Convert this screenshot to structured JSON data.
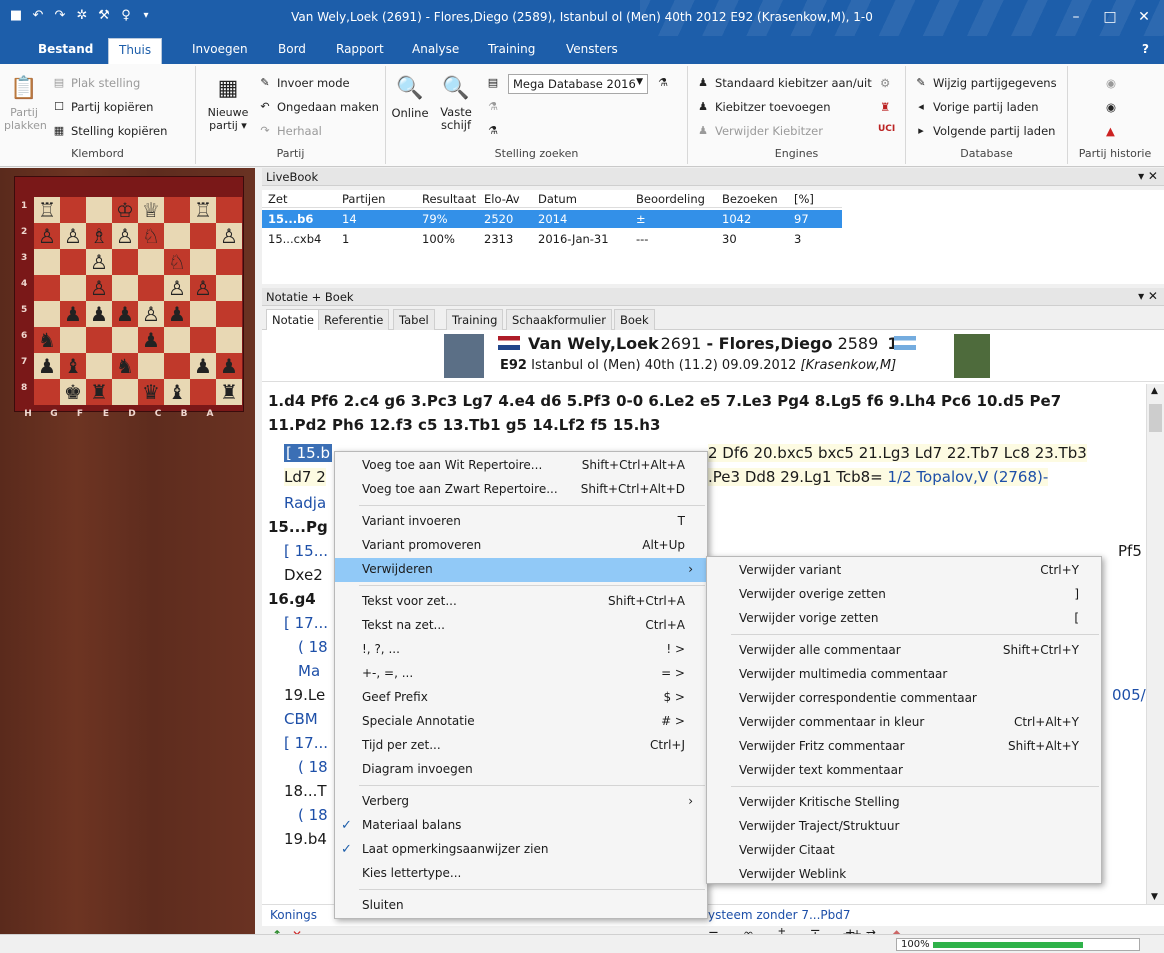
{
  "title": "Van Wely,Loek (2691) - Flores,Diego (2589), Istanbul ol (Men) 40th 2012  E92  (Krasenkow,M), 1-0",
  "menu": {
    "tabs": [
      "Bestand",
      "Thuis",
      "Invoegen",
      "Bord",
      "Rapport",
      "Analyse",
      "Training",
      "Vensters"
    ]
  },
  "ribbon": {
    "klembord": {
      "label": "Klembord",
      "partij_plakken": "Partij plakken",
      "plak_stelling": "Plak stelling",
      "partij_kopieren": "Partij kopiëren",
      "stelling_kopieren": "Stelling kopiëren"
    },
    "partij": {
      "label": "Partij",
      "nieuwe_partij": "Nieuwe partij ▾",
      "invoer_mode": "Invoer mode",
      "ongedaan": "Ongedaan maken",
      "herhaal": "Herhaal"
    },
    "stelling": {
      "label": "Stelling zoeken",
      "online": "Online",
      "vaste_schijf": "Vaste schijf",
      "database": "Mega Database 2016"
    },
    "engines": {
      "label": "Engines",
      "standaard": "Standaard kiebitzer aan/uit",
      "toevoegen": "Kiebitzer toevoegen",
      "verwijder": "Verwijder Kiebitzer"
    },
    "database": {
      "label": "Database",
      "wijzig": "Wijzig partijgegevens",
      "vorige": "Vorige partij laden",
      "volgende": "Volgende partij laden"
    },
    "historie": {
      "label": "Partij historie"
    }
  },
  "livebook": {
    "title": "LiveBook",
    "headers": [
      "Zet",
      "Partijen",
      "Resultaat",
      "Elo-Av",
      "Datum",
      "Beoordeling",
      "Bezoeken",
      "[%]"
    ],
    "rows": [
      [
        "15...b6",
        "14",
        "79%",
        "2520",
        "2014",
        "±",
        "1042",
        "97"
      ],
      [
        "15...cxb4",
        "1",
        "100%",
        "2313",
        "2016-Jan-31",
        "---",
        "30",
        "3"
      ]
    ]
  },
  "notation": {
    "title": "Notatie + Boek",
    "tabs": [
      "Notatie",
      "Referentie",
      "Tabel",
      "Training",
      "Schaakformulier",
      "Boek"
    ],
    "white": "Van Wely,Loek",
    "white_elo": "2691",
    "black": "Flores,Diego",
    "black_elo": "2589",
    "result": "1-0",
    "event": "E92",
    "event_detail": "Istanbul ol (Men) 40th (11.2) 09.09.2012",
    "annotator": "[Krasenkow,M]",
    "line1": "1.d4 Pf6 2.c4 g6 3.Pc3 Lg7 4.e4 d6 5.Pf3 0-0 6.Le2 e5 7.Le3 Pg4 8.Lg5 f6 9.Lh4 Pc6 10.d5 Pe7",
    "line2": "11.Pd2 Ph6 12.f3 c5 13.Tb1 g5 14.Lf2 f5 15.h3",
    "var1_start": "[ 15.b",
    "var1_end": "2 Df6 20.bxc5 bxc5 21.Lg3 Ld7 22.Tb7 Lc8 23.Tb3",
    "var2_start": "Ld7 2",
    "var2_end": ".Pe3 Dd8 29.Lg1 Tcb8=",
    "var2_link": "1/2 Topalov,V (2768)-",
    "radja": "Radja",
    "l_15pg": "15...Pg",
    "l_15b": "[ 15...",
    "l_pf5": "Pf5",
    "dxe2": "Dxe2",
    "l_16g4": "16.g4",
    "l_17a": "[ 17...",
    "l_18a": "( 18",
    "ma": "Ma",
    "l_19le": "19.Le",
    "l_005": "005/",
    "cbm": "CBM",
    "l_17b": "[ 17...",
    "l_18b": "( 18",
    "l_18t": "18...T",
    "l_18c": "( 18",
    "l_19b4": "19.b4",
    "bottom_left": "Konings",
    "bottom_right": "ysteem zonder 7...Pbd7"
  },
  "context_menu": {
    "items": [
      {
        "label": "Voeg toe aan Wit Repertoire...",
        "shortcut": "Shift+Ctrl+Alt+A"
      },
      {
        "label": "Voeg toe aan Zwart Repertoire...",
        "shortcut": "Shift+Ctrl+Alt+D"
      },
      {
        "label": "Variant invoeren",
        "shortcut": "T"
      },
      {
        "label": "Variant promoveren",
        "shortcut": "Alt+Up"
      },
      {
        "label": "Verwijderen",
        "shortcut": ""
      },
      {
        "label": "Tekst voor zet...",
        "shortcut": "Shift+Ctrl+A"
      },
      {
        "label": "Tekst na zet...",
        "shortcut": "Ctrl+A"
      },
      {
        "label": "!, ?, ...",
        "shortcut": "! >"
      },
      {
        "label": "+-, =, ...",
        "shortcut": "= >"
      },
      {
        "label": "Geef Prefix",
        "shortcut": "$ >"
      },
      {
        "label": "Speciale Annotatie",
        "shortcut": "# >"
      },
      {
        "label": "Tijd per zet...",
        "shortcut": "Ctrl+J"
      },
      {
        "label": "Diagram invoegen",
        "shortcut": ""
      },
      {
        "label": "Verberg",
        "shortcut": ""
      },
      {
        "label": "Materiaal balans",
        "shortcut": ""
      },
      {
        "label": "Laat opmerkingsaanwijzer zien",
        "shortcut": ""
      },
      {
        "label": "Kies lettertype...",
        "shortcut": ""
      },
      {
        "label": "Sluiten",
        "shortcut": ""
      }
    ]
  },
  "submenu": {
    "items": [
      {
        "label": "Verwijder variant",
        "shortcut": "Ctrl+Y"
      },
      {
        "label": "Verwijder overige zetten",
        "shortcut": "]"
      },
      {
        "label": "Verwijder vorige zetten",
        "shortcut": "["
      },
      {
        "label": "Verwijder alle commentaar",
        "shortcut": "Shift+Ctrl+Y"
      },
      {
        "label": "Verwijder multimedia commentaar",
        "shortcut": ""
      },
      {
        "label": "Verwijder correspondentie commentaar",
        "shortcut": ""
      },
      {
        "label": "Verwijder commentaar in kleur",
        "shortcut": "Ctrl+Alt+Y"
      },
      {
        "label": "Verwijder Fritz commentaar",
        "shortcut": "Shift+Alt+Y"
      },
      {
        "label": "Verwijder text kommentaar",
        "shortcut": ""
      },
      {
        "label": "Verwijder Kritische Stelling",
        "shortcut": ""
      },
      {
        "label": "Verwijder Traject/Struktuur",
        "shortcut": ""
      },
      {
        "label": "Verwijder Citaat",
        "shortcut": ""
      },
      {
        "label": "Verwijder Weblink",
        "shortcut": ""
      }
    ]
  },
  "board": {
    "ranks": [
      "1",
      "2",
      "3",
      "4",
      "5",
      "6",
      "7",
      "8"
    ],
    "files": [
      "H",
      "G",
      "F",
      "E",
      "D",
      "C",
      "B",
      "A"
    ],
    "rows": [
      [
        "♖",
        "",
        "",
        "♔",
        "♕",
        "",
        "♖",
        ""
      ],
      [
        "♙",
        "♙",
        "♗",
        "♙",
        "♘",
        "",
        "",
        "♙"
      ],
      [
        "",
        "",
        "♙",
        "",
        "",
        "♘",
        "",
        ""
      ],
      [
        "",
        "",
        "♙",
        "",
        "",
        "♙",
        "♙",
        ""
      ],
      [
        "",
        "♟",
        "♟",
        "♟",
        "♙",
        "♟",
        "",
        ""
      ],
      [
        "♞",
        "",
        "",
        "",
        "♟",
        "",
        "",
        ""
      ],
      [
        "♟",
        "♝",
        "",
        "♞",
        "",
        "",
        "♟",
        "♟"
      ],
      [
        "",
        "♚",
        "♜",
        "",
        "♛",
        "♝",
        "",
        "♜"
      ]
    ]
  },
  "status": {
    "progress_label": "100%",
    "progress": 1.0
  }
}
